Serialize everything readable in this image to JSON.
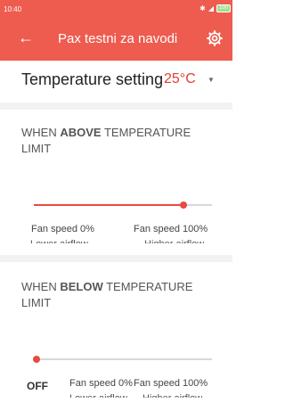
{
  "status": {
    "time": "10:40",
    "battery": "100"
  },
  "appbar": {
    "title": "Pax testni za navodi"
  },
  "temperature": {
    "label": "Temperature setting",
    "value": "25°C"
  },
  "above": {
    "title_pre": "WHEN ",
    "title_bold": "ABOVE",
    "title_post": " TEMPERATURE LIMIT",
    "slider_value_fraction": 0.84,
    "fan_low": "Fan speed 0%",
    "fan_high": "Fan speed 100%",
    "sub_low": "Lower airflow",
    "sub_high": "Higher airflow"
  },
  "below": {
    "title_pre": "WHEN ",
    "title_bold": "BELOW",
    "title_post": " TEMPERATURE LIMIT",
    "slider_value_fraction": 0.0,
    "off_label": "OFF",
    "fan_low": "Fan speed 0%",
    "fan_high": "Fan speed 100%",
    "sub_low": "Lower airflow",
    "sub_high": "Higher airflow"
  },
  "colors": {
    "accent": "#ee5b4f",
    "slider": "#e84a42",
    "temp_value": "#e43b34"
  },
  "icons": {
    "back": "arrow-left-icon",
    "settings": "gear-icon",
    "dropdown": "caret-down-icon",
    "wifi": "wifi-icon",
    "battery": "battery-icon"
  }
}
